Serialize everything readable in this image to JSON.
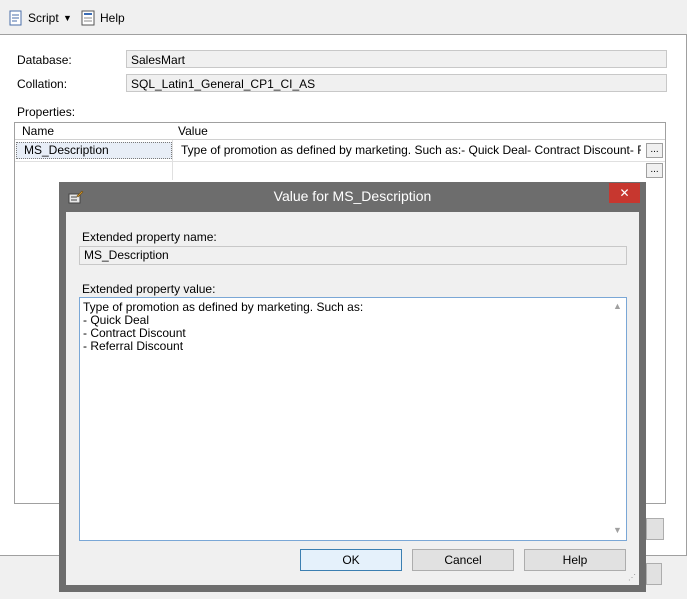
{
  "toolbar": {
    "script_label": "Script",
    "help_label": "Help"
  },
  "form": {
    "database_label": "Database:",
    "database_value": "SalesMart",
    "collation_label": "Collation:",
    "collation_value": "SQL_Latin1_General_CP1_CI_AS",
    "properties_label": "Properties:"
  },
  "grid": {
    "columns": [
      "Name",
      "Value"
    ],
    "rows": [
      {
        "name": "MS_Description",
        "value": "Type of promotion as defined by marketing.  Such as:- Quick Deal- Contract Discount- Referral ..."
      },
      {
        "name": "",
        "value": ""
      }
    ],
    "ellipsis": "..."
  },
  "dialog": {
    "title": "Value for MS_Description",
    "name_label": "Extended property name:",
    "name_value": "MS_Description",
    "value_label": "Extended property value:",
    "value_text": "Type of promotion as defined by marketing.  Such as:\n- Quick Deal\n- Contract Discount\n- Referral Discount",
    "ok_label": "OK",
    "cancel_label": "Cancel",
    "help_label": "Help",
    "close_glyph": "✕"
  },
  "colors": {
    "close_button": "#c7372f",
    "dialog_frame": "#6d6d6d",
    "selected_row": "#e8eef7"
  }
}
